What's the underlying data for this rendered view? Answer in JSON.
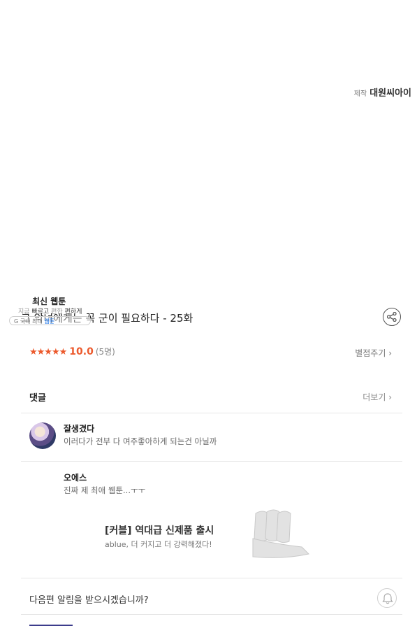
{
  "producer": {
    "prefix": "제작",
    "name": "대원씨아이"
  },
  "promo": {
    "title": "최신 웹툰",
    "subtitle_a": "지금 ",
    "subtitle_b": "빠르고 ",
    "subtitle_c": "편한 ",
    "subtitle_d": "편하게",
    "pill_text": "G 국내 최대 ",
    "pill_badge": "웹툰"
  },
  "episode": {
    "title": "그 악녀에게는 꼭 군이 필요하다 - 25화"
  },
  "rating": {
    "stars": "★★★★★",
    "score": "10.0",
    "count": "(5명)",
    "rate_label": "별점주기 ›"
  },
  "comments": {
    "header": "댓글",
    "more_label": "더보기 ›",
    "items": [
      {
        "user": "잘생겼다",
        "text": "이러다가 전부 다 여주좋아하게 되는건 아닐까"
      },
      {
        "user": "오에스",
        "text": "진짜 제 최애 웹툰...ㅜㅜ"
      }
    ]
  },
  "ad": {
    "title": "[커블] 역대급 신제품 출시",
    "subtitle": "ablue, 더 커지고 더 강력해졌다!"
  },
  "notify": {
    "label": "다음편 알림을 받으시겠습니까?"
  },
  "colors": {
    "accent": "#ec5a2d",
    "divider": "#e6e6e6"
  }
}
